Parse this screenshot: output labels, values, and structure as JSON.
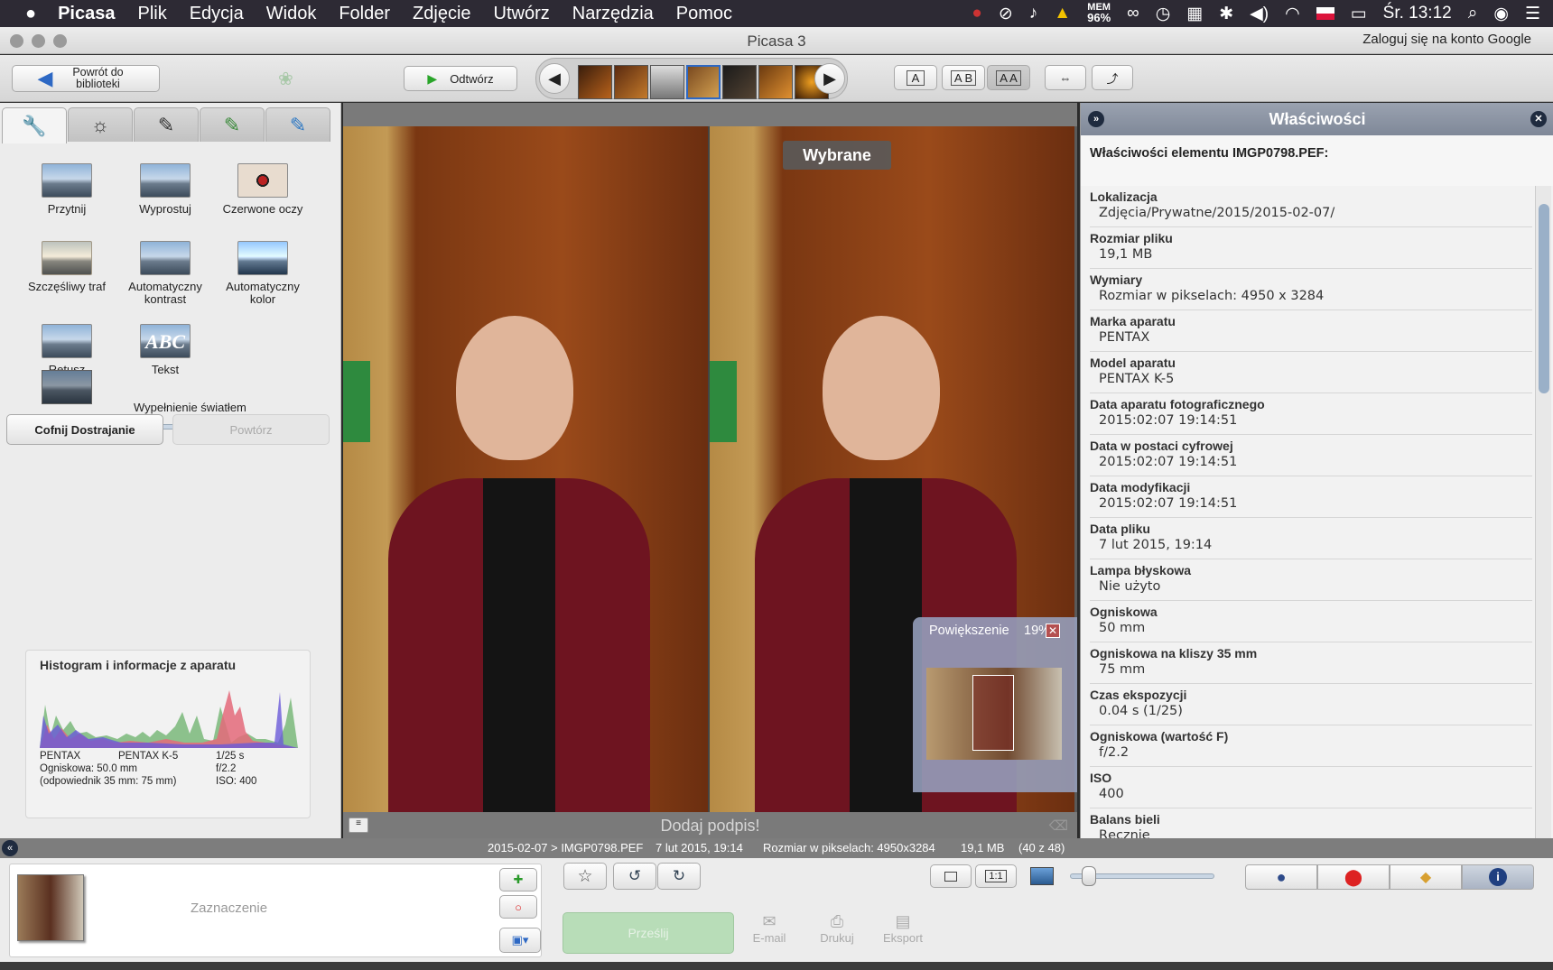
{
  "menubar": {
    "apple": "",
    "items": [
      "Picasa",
      "Plik",
      "Edycja",
      "Widok",
      "Folder",
      "Zdjęcie",
      "Utwórz",
      "Narzędzia",
      "Pomoc"
    ],
    "mem_label": "MEM",
    "mem_value": "96%",
    "clock": "Śr. 13:12"
  },
  "window": {
    "title": "Picasa 3",
    "login": "Zaloguj się na konto Google"
  },
  "toolbar": {
    "back_label": "Powrót do biblioteki",
    "play_label": "Odtwórz",
    "view_a": "A",
    "view_ab": "A B",
    "view_aa": "A A"
  },
  "tools": {
    "items": [
      "Przytnij",
      "Wyprostuj",
      "Czerwone oczy",
      "Szczęśliwy traf",
      "Automatyczny kontrast",
      "Automatyczny kolor",
      "Retusz",
      "Tekst"
    ],
    "text_icon": "ABC",
    "fill_light_label": "Wypełnienie światłem",
    "fill_light_value": 0,
    "undo_label": "Cofnij Dostrajanie",
    "redo_label": "Powtórz"
  },
  "histogram": {
    "title": "Histogram i informacje z aparatu",
    "col1": [
      "PENTAX",
      "Ogniskowa: 50.0 mm",
      "(odpowiednik 35 mm:  75 mm)"
    ],
    "col2": [
      "PENTAX K-5"
    ],
    "col3": [
      "1/25 s",
      "f/2.2",
      "ISO: 400"
    ]
  },
  "viewer": {
    "badge": "Wybrane",
    "caption": "Dodaj podpis!",
    "zoom_label": "Powiększenie",
    "zoom_value": "19%"
  },
  "properties": {
    "title": "Właściwości",
    "heading": "Właściwości elementu IMGP0798.PEF:",
    "items": [
      {
        "k": "Lokalizacja",
        "v": "Zdjęcia/Prywatne/2015/2015-02-07/"
      },
      {
        "k": "Rozmiar pliku",
        "v": "19,1 MB"
      },
      {
        "k": "Wymiary",
        "v": "Rozmiar w pikselach: 4950 x 3284"
      },
      {
        "k": "Marka aparatu",
        "v": "PENTAX"
      },
      {
        "k": "Model aparatu",
        "v": "PENTAX K-5"
      },
      {
        "k": "Data aparatu fotograficznego",
        "v": "2015:02:07 19:14:51"
      },
      {
        "k": "Data w postaci cyfrowej",
        "v": "2015:02:07 19:14:51"
      },
      {
        "k": "Data modyfikacji",
        "v": "2015:02:07 19:14:51"
      },
      {
        "k": "Data pliku",
        "v": "7 lut 2015, 19:14"
      },
      {
        "k": "Lampa błyskowa",
        "v": "Nie użyto"
      },
      {
        "k": "Ogniskowa",
        "v": "50 mm"
      },
      {
        "k": "Ogniskowa na kliszy 35 mm",
        "v": "75 mm"
      },
      {
        "k": "Czas ekspozycji",
        "v": "0.04 s (1/25)"
      },
      {
        "k": "Ogniskowa (wartość F)",
        "v": "f/2.2"
      },
      {
        "k": "ISO",
        "v": "400"
      },
      {
        "k": "Balans bieli",
        "v": "Ręcznie"
      }
    ]
  },
  "status": {
    "path": "2015-02-07 > IMGP0798.PEF",
    "date": "7 lut 2015, 19:14",
    "dims": "Rozmiar w pikselach: 4950x3284",
    "size": "19,1 MB",
    "count": "(40 z 48)"
  },
  "bottom": {
    "selection": "Zaznaczenie",
    "share": "Prześlij",
    "email": "E-mail",
    "print": "Drukuj",
    "export": "Eksport",
    "zoom_1_1": "1:1"
  }
}
